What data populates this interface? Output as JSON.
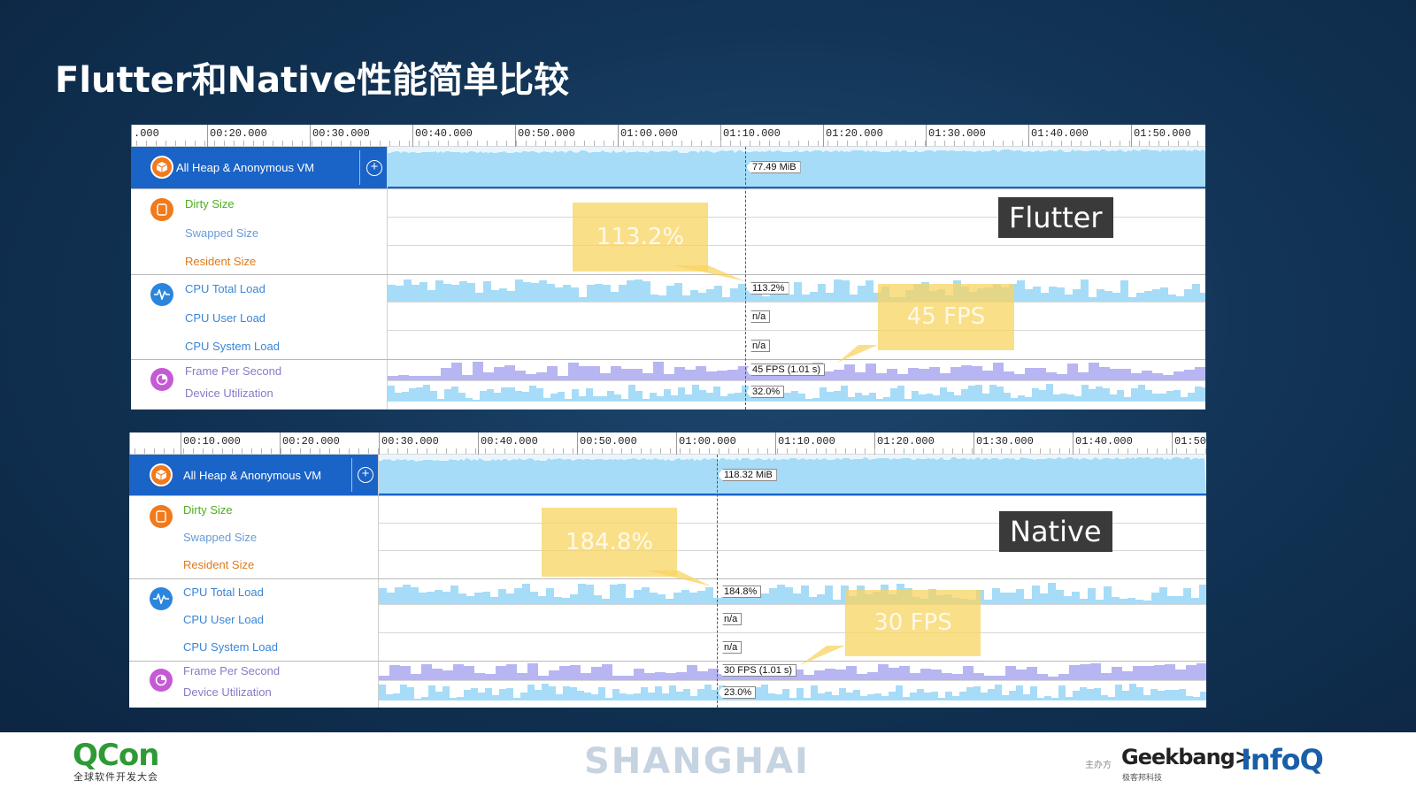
{
  "slide": {
    "title": "Flutter和Native性能简单比较"
  },
  "panels": [
    {
      "id": "flutter",
      "badge": "Flutter",
      "ruler_ticks": [
        ".000",
        "00:20.000",
        "00:30.000",
        "00:40.000",
        "00:50.000",
        "01:00.000",
        "01:10.000",
        "01:20.000",
        "01:30.000",
        "01:40.000",
        "01:50.000"
      ],
      "heap": {
        "label": "All Heap & Anonymous VM",
        "plus": "+",
        "value": "77.49 MiB"
      },
      "memory_rows": {
        "dirty": "Dirty Size",
        "swapped": "Swapped Size",
        "resident": "Resident Size"
      },
      "cpu_rows": {
        "total": "CPU Total Load",
        "user": "CPU User Load",
        "system": "CPU System Load",
        "total_value": "113.2%",
        "user_value": "n/a",
        "system_value": "n/a"
      },
      "gpu_rows": {
        "fps": "Frame Per Second",
        "device": "Device Utilization",
        "fps_value": "45 FPS (1.01 s)",
        "device_value": "32.0%"
      },
      "callouts": {
        "cpu": "113.2%",
        "fps": "45 FPS"
      }
    },
    {
      "id": "native",
      "badge": "Native",
      "ruler_ticks": [
        "",
        "00:10.000",
        "00:20.000",
        "00:30.000",
        "00:40.000",
        "00:50.000",
        "01:00.000",
        "01:10.000",
        "01:20.000",
        "01:30.000",
        "01:40.000",
        "01:50."
      ],
      "heap": {
        "label": "All Heap & Anonymous VM",
        "plus": "+",
        "value": "118.32 MiB"
      },
      "memory_rows": {
        "dirty": "Dirty Size",
        "swapped": "Swapped Size",
        "resident": "Resident Size"
      },
      "cpu_rows": {
        "total": "CPU Total Load",
        "user": "CPU User Load",
        "system": "CPU System Load",
        "total_value": "184.8%",
        "user_value": "n/a",
        "system_value": "n/a"
      },
      "gpu_rows": {
        "fps": "Frame Per Second",
        "device": "Device Utilization",
        "fps_value": "30 FPS (1.01 s)",
        "device_value": "23.0%"
      },
      "callouts": {
        "cpu": "184.8%",
        "fps": "30 FPS"
      }
    }
  ],
  "footer": {
    "qcon": "QCon",
    "qcon_sub": "全球软件开发大会",
    "city": "SHANGHAI",
    "host_label": "主办方",
    "geekbang": "Geekbang>.",
    "geekbang_sub": "极客邦科技",
    "infoq": "InfoQ"
  },
  "colors": {
    "selected_row": "#1a63c7",
    "heap_fill": "#a6dcf7",
    "cpu_fill": "#a6dcf7",
    "fps_fill": "#b7b5f2",
    "device_fill": "#a6dcf7",
    "dirty_text": "#4caf1e",
    "swapped_text": "#6a9bd8",
    "resident_text": "#e07a18",
    "cpu_text": "#3a86d6",
    "gpu_text": "#8a7ac8",
    "callout": "#f8d462"
  }
}
